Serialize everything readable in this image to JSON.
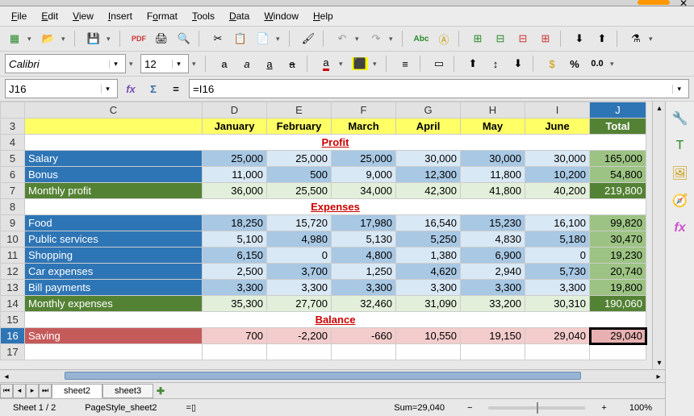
{
  "menu": [
    "File",
    "Edit",
    "View",
    "Insert",
    "Format",
    "Tools",
    "Data",
    "Window",
    "Help"
  ],
  "font": {
    "name": "Calibri",
    "size": "12"
  },
  "cellref": "J16",
  "formula": "=I16",
  "columns": [
    "C",
    "D",
    "E",
    "F",
    "G",
    "H",
    "I",
    "J"
  ],
  "header": {
    "months": [
      "January",
      "February",
      "March",
      "April",
      "May",
      "June"
    ],
    "total": "Total"
  },
  "sections": {
    "profit": "Profit",
    "expenses": "Expenses",
    "balance": "Balance"
  },
  "rows": {
    "salary": {
      "label": "Salary",
      "vals": [
        "25,000",
        "25,000",
        "25,000",
        "30,000",
        "30,000",
        "30,000"
      ],
      "tot": "165,000"
    },
    "bonus": {
      "label": "Bonus",
      "vals": [
        "11,000",
        "500",
        "9,000",
        "12,300",
        "11,800",
        "10,200"
      ],
      "tot": "54,800"
    },
    "mprofit": {
      "label": "Monthly profit",
      "vals": [
        "36,000",
        "25,500",
        "34,000",
        "42,300",
        "41,800",
        "40,200"
      ],
      "tot": "219,800"
    },
    "food": {
      "label": "Food",
      "vals": [
        "18,250",
        "15,720",
        "17,980",
        "16,540",
        "15,230",
        "16,100"
      ],
      "tot": "99,820"
    },
    "public": {
      "label": "Public services",
      "vals": [
        "5,100",
        "4,980",
        "5,130",
        "5,250",
        "4,830",
        "5,180"
      ],
      "tot": "30,470"
    },
    "shopping": {
      "label": "Shopping",
      "vals": [
        "6,150",
        "0",
        "4,800",
        "1,380",
        "6,900",
        "0"
      ],
      "tot": "19,230"
    },
    "car": {
      "label": "Car expenses",
      "vals": [
        "2,500",
        "3,700",
        "1,250",
        "4,620",
        "2,940",
        "5,730"
      ],
      "tot": "20,740"
    },
    "bill": {
      "label": "Bill payments",
      "vals": [
        "3,300",
        "3,300",
        "3,300",
        "3,300",
        "3,300",
        "3,300"
      ],
      "tot": "19,800"
    },
    "mexp": {
      "label": "Monthly expenses",
      "vals": [
        "35,300",
        "27,700",
        "32,460",
        "31,090",
        "33,200",
        "30,310"
      ],
      "tot": "190,060"
    },
    "saving": {
      "label": "Saving",
      "vals": [
        "700",
        "-2,200",
        "-660",
        "10,550",
        "19,150",
        "29,040"
      ],
      "tot": "29,040"
    }
  },
  "tabs": [
    "sheet2",
    "sheet3"
  ],
  "status": {
    "sheet": "Sheet 1 / 2",
    "style": "PageStyle_sheet2",
    "sum": "Sum=29,040",
    "zoom": "100%"
  },
  "percent": "%",
  "zerozer": "0.0"
}
